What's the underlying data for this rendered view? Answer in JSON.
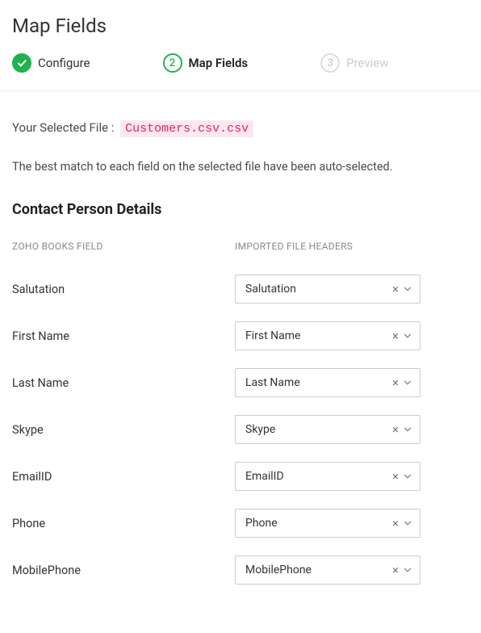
{
  "page_title": "Map Fields",
  "stepper": {
    "steps": [
      {
        "num": "1",
        "label": "Configure",
        "state": "done"
      },
      {
        "num": "2",
        "label": "Map Fields",
        "state": "active"
      },
      {
        "num": "3",
        "label": "Preview",
        "state": "pending"
      }
    ]
  },
  "selected_file": {
    "prefix": "Your Selected File :",
    "name": "Customers.csv.csv"
  },
  "hint": "The best match to each field on the selected file have been auto-selected.",
  "section_title": "Contact Person Details",
  "columns": {
    "left": "ZOHO BOOKS FIELD",
    "right": "IMPORTED FILE HEADERS"
  },
  "fields": [
    {
      "label": "Salutation",
      "value": "Salutation"
    },
    {
      "label": "First Name",
      "value": "First Name"
    },
    {
      "label": "Last Name",
      "value": "Last Name"
    },
    {
      "label": "Skype",
      "value": "Skype"
    },
    {
      "label": "EmailID",
      "value": "EmailID"
    },
    {
      "label": "Phone",
      "value": "Phone"
    },
    {
      "label": "MobilePhone",
      "value": "MobilePhone"
    }
  ]
}
